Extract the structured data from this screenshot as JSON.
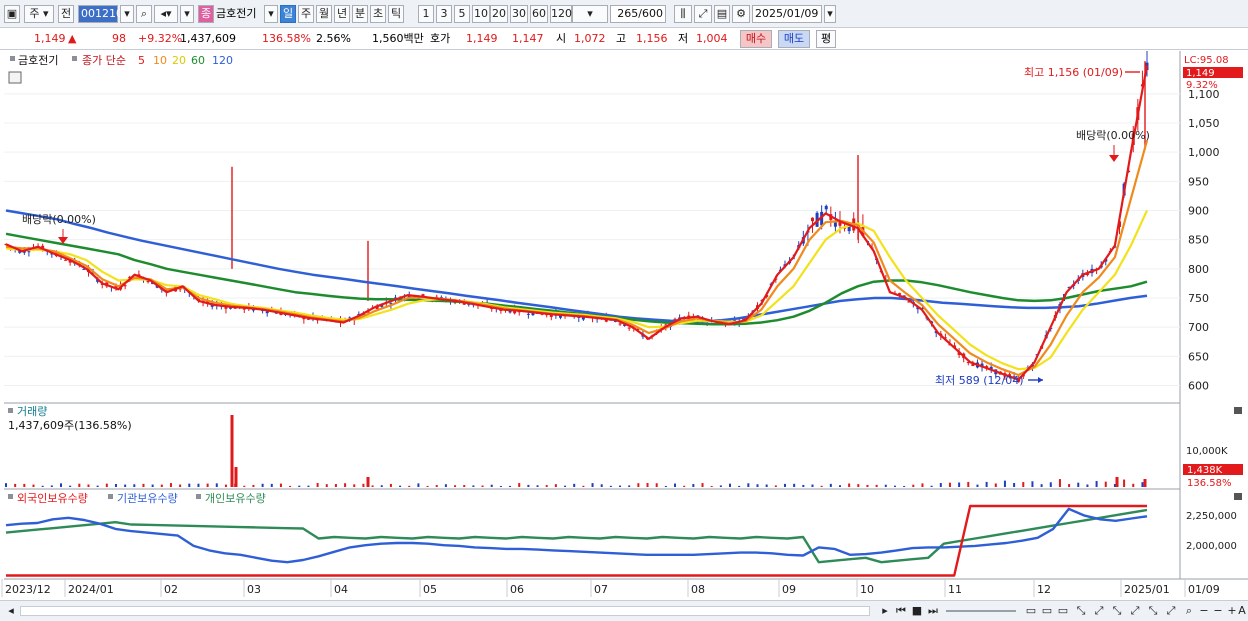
{
  "toolbar": {
    "market": "주",
    "prev": "전",
    "code": "001210",
    "stock_name": "금호전기",
    "period_buttons": [
      "일",
      "주",
      "월",
      "년",
      "분",
      "초",
      "틱"
    ],
    "interval_buttons": [
      "1",
      "3",
      "5",
      "10",
      "20",
      "30",
      "60",
      "120"
    ],
    "count": "265/600",
    "date": "2025/01/09"
  },
  "quote": {
    "price": "1,149",
    "arrow": "▲",
    "change": "98",
    "change_pct": "+9.32%",
    "volume": "1,437,609",
    "volume_ratio": "136.58%",
    "turnover": "2.56%",
    "amount": "1,560백만",
    "hoga_label": "호가",
    "ask": "1,149",
    "bid": "1,147",
    "open_label": "시",
    "open": "1,072",
    "high_label": "고",
    "high": "1,156",
    "low_label": "저",
    "low": "1,004",
    "buy_label": "매수",
    "sell_label": "매도",
    "avg_label": "평"
  },
  "legend": {
    "name": "금호전기",
    "ma_title": "종가 단순",
    "ma_periods": [
      "5",
      "10",
      "20",
      "60",
      "120"
    ],
    "lc_value": "LC:95.08",
    "current_price_tag": "1,149",
    "current_pct_tag": "9.32%"
  },
  "annotations": {
    "high": "최고 1,156 (01/09)",
    "low": "최저 589 (12/04)",
    "dividend": "배당락(0.00%)"
  },
  "volume_panel": {
    "title": "거래량",
    "info": "1,437,609주(136.58%)",
    "axis_label": "10,000K",
    "current_tag": "1,438K",
    "current_pct_tag": "136.58%"
  },
  "holding_panel": {
    "series": [
      "외국인보유수량",
      "기관보유수량",
      "개인보유수량"
    ],
    "axis_labels": [
      "2,250,000",
      "2,000,000"
    ]
  },
  "x_labels": [
    "2023/12",
    "2024/01",
    "02",
    "03",
    "04",
    "05",
    "06",
    "07",
    "08",
    "09",
    "10",
    "11",
    "12",
    "2025/01",
    "01/09"
  ],
  "price_axis": [
    "1,100",
    "1,050",
    "1,000",
    "950",
    "900",
    "850",
    "800",
    "750",
    "700",
    "650",
    "600"
  ],
  "colors": {
    "up": "#e0191b",
    "down": "#1f3fbf",
    "ma5": "#e31a1c",
    "ma10": "#f08a1c",
    "ma20": "#f2e21a",
    "ma60": "#1e8c2e",
    "ma120": "#2f5fd6",
    "foreign": "#e31a1c",
    "institution": "#2f5fd6",
    "individual": "#2e8b57"
  },
  "chart_data": {
    "type": "candlestick",
    "ylim": [
      570,
      1170
    ],
    "series": [
      {
        "name": "5",
        "values": [
          842,
          830,
          838,
          826,
          815,
          800,
          775,
          765,
          790,
          780,
          760,
          770,
          745,
          738,
          735,
          733,
          730,
          725,
          720,
          715,
          712,
          708,
          720,
          735,
          745,
          755,
          752,
          748,
          745,
          740,
          735,
          730,
          728,
          725,
          722,
          720,
          718,
          715,
          712,
          700,
          680,
          700,
          715,
          718,
          710,
          705,
          712,
          740,
          790,
          820,
          870,
          895,
          880,
          870,
          830,
          760,
          750,
          730,
          690,
          665,
          640,
          630,
          620,
          610,
          640,
          700,
          760,
          790,
          800,
          840,
          1000,
          1149
        ]
      },
      {
        "name": "10",
        "values": [
          838,
          835,
          835,
          830,
          818,
          805,
          782,
          770,
          785,
          782,
          765,
          768,
          750,
          742,
          737,
          734,
          731,
          727,
          722,
          717,
          713,
          710,
          716,
          728,
          738,
          750,
          751,
          749,
          746,
          742,
          737,
          732,
          729,
          726,
          723,
          721,
          719,
          716,
          713,
          704,
          690,
          698,
          710,
          715,
          711,
          707,
          710,
          730,
          770,
          800,
          850,
          880,
          882,
          875,
          845,
          780,
          758,
          738,
          705,
          680,
          655,
          640,
          628,
          618,
          632,
          670,
          720,
          760,
          785,
          820,
          920,
          1020
        ]
      },
      {
        "name": "20",
        "values": [
          835,
          832,
          833,
          830,
          825,
          815,
          795,
          780,
          782,
          781,
          772,
          770,
          755,
          748,
          740,
          736,
          733,
          729,
          725,
          720,
          716,
          713,
          714,
          722,
          730,
          740,
          746,
          748,
          746,
          743,
          739,
          734,
          731,
          728,
          725,
          723,
          721,
          718,
          715,
          709,
          700,
          701,
          707,
          711,
          711,
          709,
          709,
          720,
          745,
          770,
          810,
          850,
          870,
          878,
          865,
          820,
          780,
          750,
          720,
          695,
          670,
          652,
          638,
          628,
          630,
          648,
          690,
          730,
          760,
          790,
          840,
          900
        ]
      },
      {
        "name": "60",
        "values": [
          860,
          855,
          850,
          845,
          840,
          835,
          830,
          825,
          815,
          808,
          800,
          795,
          790,
          785,
          780,
          775,
          770,
          765,
          760,
          757,
          754,
          751,
          749,
          748,
          748,
          747,
          746,
          745,
          744,
          742,
          740,
          737,
          734,
          731,
          728,
          725,
          722,
          719,
          716,
          713,
          710,
          708,
          707,
          706,
          705,
          705,
          706,
          708,
          712,
          718,
          728,
          742,
          758,
          770,
          778,
          780,
          780,
          777,
          772,
          766,
          760,
          755,
          750,
          746,
          745,
          746,
          750,
          756,
          762,
          766,
          770,
          778
        ]
      },
      {
        "name": "120",
        "values": [
          900,
          895,
          890,
          885,
          877,
          870,
          862,
          855,
          848,
          842,
          836,
          830,
          824,
          818,
          812,
          806,
          800,
          795,
          790,
          786,
          782,
          778,
          774,
          770,
          766,
          762,
          758,
          754,
          750,
          746,
          742,
          738,
          734,
          730,
          726,
          722,
          718,
          715,
          713,
          711,
          710,
          710,
          712,
          715,
          720,
          725,
          730,
          735,
          740,
          745,
          748,
          750,
          750,
          748,
          745,
          742,
          740,
          738,
          736,
          734,
          733,
          733,
          734,
          736,
          740,
          745,
          750,
          754
        ]
      }
    ],
    "holding": {
      "foreign": [
        2.0,
        2.0,
        2.0,
        2.0,
        2.0,
        2.0,
        2.0,
        2.0,
        2.0,
        2.0,
        2.0,
        2.0,
        2.0,
        2.0,
        2.0,
        2.0,
        2.0,
        2.0,
        2.0,
        2.0,
        2.0,
        2.0,
        2.0,
        2.0,
        2.0,
        2.0,
        2.0,
        2.0,
        2.0,
        2.0,
        2.0,
        2.0,
        2.0,
        2.0,
        2.0,
        2.0,
        2.0,
        2.0,
        2.0,
        2.0,
        2.0,
        2.0,
        2.0,
        2.0,
        2.0,
        2.0,
        2.0,
        2.0,
        2.0,
        2.0,
        2.0,
        2.0,
        2.0,
        2.0,
        2.0,
        2.0,
        2.0,
        2.0,
        2.0,
        2.0,
        9.0,
        9.0,
        9.0,
        9.0,
        9.0,
        9.0,
        9.0,
        9.0,
        9.0,
        9.0,
        9.0,
        9.0
      ],
      "institution": [
        7.0,
        7.2,
        7.3,
        7.8,
        8.0,
        7.7,
        7.2,
        6.5,
        6.2,
        6.0,
        5.8,
        5.6,
        4.2,
        3.6,
        3.2,
        3.0,
        2.6,
        2.2,
        2.0,
        2.3,
        2.8,
        3.4,
        4.0,
        4.3,
        4.5,
        4.6,
        4.6,
        4.5,
        4.3,
        4.2,
        4.0,
        3.9,
        3.8,
        3.8,
        3.7,
        3.6,
        3.5,
        3.4,
        3.3,
        3.2,
        3.1,
        3.0,
        3.0,
        3.0,
        3.0,
        3.1,
        3.2,
        3.3,
        3.3,
        3.2,
        3.0,
        2.9,
        4.0,
        3.8,
        3.0,
        3.1,
        3.3,
        3.6,
        3.9,
        4.0,
        4.0,
        4.1,
        4.2,
        4.4,
        4.6,
        4.9,
        5.3,
        6.5,
        9.2,
        8.3,
        7.8,
        7.6,
        7.9,
        8.2
      ]
    }
  }
}
